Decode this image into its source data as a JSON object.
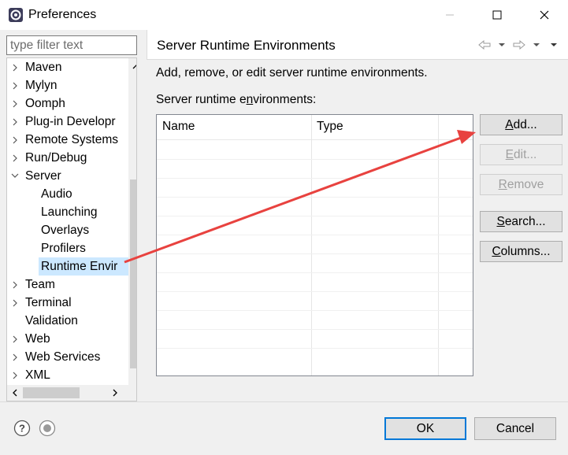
{
  "window": {
    "title": "Preferences",
    "icon": "eclipse-gear-icon",
    "controls": [
      "minimize-icon",
      "maximize-icon",
      "close-icon"
    ]
  },
  "filter": {
    "placeholder": "type filter text",
    "value": ""
  },
  "tree": {
    "items": [
      {
        "label": "Maven",
        "expandable": true,
        "expanded": false,
        "level": 0
      },
      {
        "label": "Mylyn",
        "expandable": true,
        "expanded": false,
        "level": 0
      },
      {
        "label": "Oomph",
        "expandable": true,
        "expanded": false,
        "level": 0
      },
      {
        "label": "Plug-in Developr",
        "expandable": true,
        "expanded": false,
        "level": 0
      },
      {
        "label": "Remote Systems",
        "expandable": true,
        "expanded": false,
        "level": 0
      },
      {
        "label": "Run/Debug",
        "expandable": true,
        "expanded": false,
        "level": 0
      },
      {
        "label": "Server",
        "expandable": true,
        "expanded": true,
        "level": 0
      },
      {
        "label": "Audio",
        "expandable": false,
        "level": 1
      },
      {
        "label": "Launching",
        "expandable": false,
        "level": 1
      },
      {
        "label": "Overlays",
        "expandable": false,
        "level": 1
      },
      {
        "label": "Profilers",
        "expandable": false,
        "level": 1
      },
      {
        "label": "Runtime Envir",
        "expandable": false,
        "level": 1,
        "selected": true
      },
      {
        "label": "Team",
        "expandable": true,
        "expanded": false,
        "level": 0
      },
      {
        "label": "Terminal",
        "expandable": true,
        "expanded": false,
        "level": 0
      },
      {
        "label": "Validation",
        "expandable": false,
        "level": 0
      },
      {
        "label": "Web",
        "expandable": true,
        "expanded": false,
        "level": 0
      },
      {
        "label": "Web Services",
        "expandable": true,
        "expanded": false,
        "level": 0
      },
      {
        "label": "XML",
        "expandable": true,
        "expanded": false,
        "level": 0
      }
    ]
  },
  "page": {
    "title": "Server Runtime Environments",
    "description": "Add, remove, or edit server runtime environments.",
    "table_label": "Server runtime environments:",
    "columns": [
      "Name",
      "Type"
    ],
    "rows": []
  },
  "buttons": {
    "add": "Add...",
    "edit": "Edit...",
    "remove": "Remove",
    "search": "Search...",
    "columns": "Columns..."
  },
  "footer": {
    "ok": "OK",
    "cancel": "Cancel"
  },
  "colors": {
    "selection": "#cce8ff",
    "annotation_arrow": "#e8423f",
    "default_button_border": "#0078d7"
  }
}
